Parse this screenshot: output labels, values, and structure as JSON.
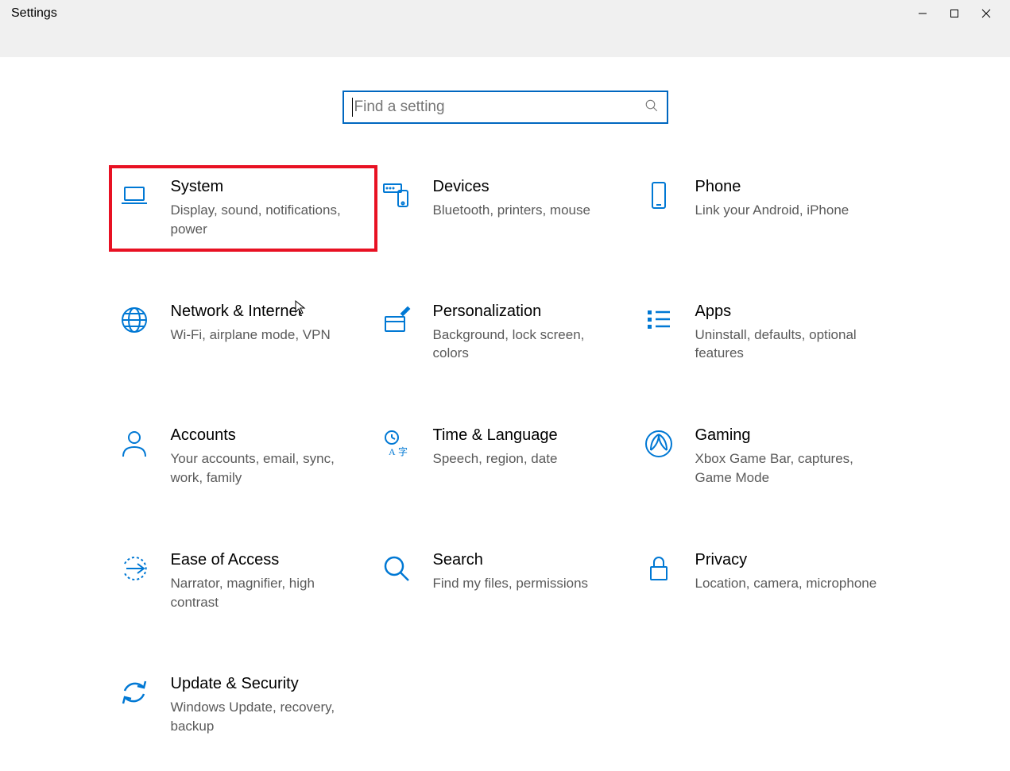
{
  "window": {
    "title": "Settings"
  },
  "search": {
    "placeholder": "Find a setting"
  },
  "tiles": [
    {
      "title": "System",
      "desc": "Display, sound, notifications, power",
      "icon": "laptop-icon",
      "highlighted": true
    },
    {
      "title": "Devices",
      "desc": "Bluetooth, printers, mouse",
      "icon": "devices-icon",
      "highlighted": false
    },
    {
      "title": "Phone",
      "desc": "Link your Android, iPhone",
      "icon": "phone-icon",
      "highlighted": false
    },
    {
      "title": "Network & Internet",
      "desc": "Wi-Fi, airplane mode, VPN",
      "icon": "globe-icon",
      "highlighted": false
    },
    {
      "title": "Personalization",
      "desc": "Background, lock screen, colors",
      "icon": "brush-icon",
      "highlighted": false
    },
    {
      "title": "Apps",
      "desc": "Uninstall, defaults, optional features",
      "icon": "list-icon",
      "highlighted": false
    },
    {
      "title": "Accounts",
      "desc": "Your accounts, email, sync, work, family",
      "icon": "person-icon",
      "highlighted": false
    },
    {
      "title": "Time & Language",
      "desc": "Speech, region, date",
      "icon": "time-lang-icon",
      "highlighted": false
    },
    {
      "title": "Gaming",
      "desc": "Xbox Game Bar, captures, Game Mode",
      "icon": "gaming-icon",
      "highlighted": false
    },
    {
      "title": "Ease of Access",
      "desc": "Narrator, magnifier, high contrast",
      "icon": "ease-icon",
      "highlighted": false
    },
    {
      "title": "Search",
      "desc": "Find my files, permissions",
      "icon": "search-icon",
      "highlighted": false
    },
    {
      "title": "Privacy",
      "desc": "Location, camera, microphone",
      "icon": "lock-icon",
      "highlighted": false
    },
    {
      "title": "Update & Security",
      "desc": "Windows Update, recovery, backup",
      "icon": "update-icon",
      "highlighted": false
    }
  ],
  "colors": {
    "accent": "#0078d4",
    "highlight": "#e81123"
  }
}
